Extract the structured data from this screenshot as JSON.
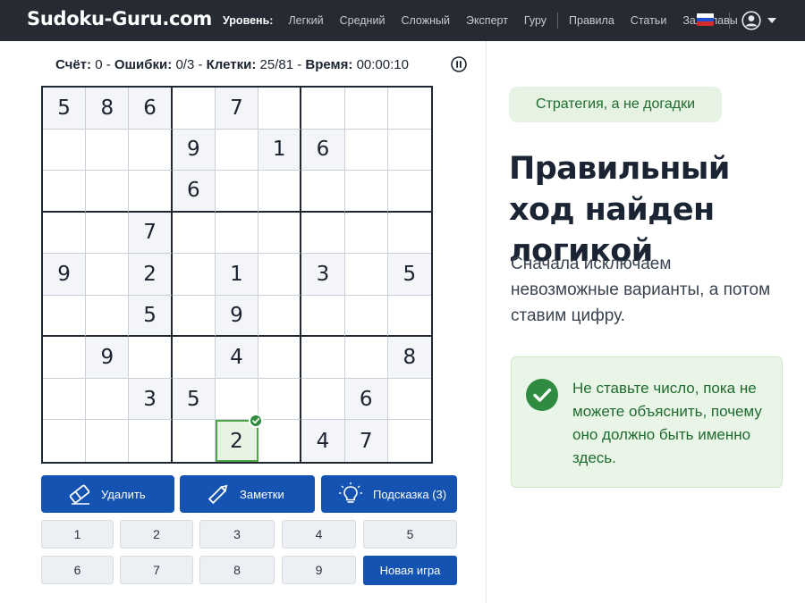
{
  "header": {
    "logo": "Sudoku-Guru.com",
    "level_label": "Уровень:",
    "levels": [
      "Легкий",
      "Средний",
      "Сложный",
      "Эксперт",
      "Гуру"
    ],
    "links": [
      "Правила",
      "Статьи",
      "Зал славы"
    ],
    "language_flag": "russian-flag-icon",
    "user_icon": "user-avatar-icon"
  },
  "status": {
    "score_label": "Счёт:",
    "score": "0",
    "errors_label": "Ошибки:",
    "errors": "0/3",
    "cells_label": "Клетки:",
    "cells": "25/81",
    "time_label": "Время:",
    "time": "00:00:10"
  },
  "grid": [
    [
      "5",
      "8",
      "6",
      "",
      "7",
      "",
      "",
      "",
      ""
    ],
    [
      "",
      "",
      "",
      "9",
      "",
      "1",
      "6",
      "",
      ""
    ],
    [
      "",
      "",
      "",
      "6",
      "",
      "",
      "",
      "",
      ""
    ],
    [
      "",
      "",
      "7",
      "",
      "",
      "",
      "",
      "",
      ""
    ],
    [
      "9",
      "",
      "2",
      "",
      "1",
      "",
      "3",
      "",
      "5"
    ],
    [
      "",
      "",
      "5",
      "",
      "9",
      "",
      "",
      "",
      ""
    ],
    [
      "",
      "9",
      "",
      "",
      "4",
      "",
      "",
      "",
      "8"
    ],
    [
      "",
      "",
      "3",
      "5",
      "",
      "",
      "",
      "6",
      ""
    ],
    [
      "",
      "",
      "",
      "",
      "2",
      "",
      "4",
      "7",
      ""
    ]
  ],
  "selected_cell": {
    "row": 9,
    "col": 5,
    "value": "2",
    "status": "correct"
  },
  "actions": {
    "delete": "Удалить",
    "notes": "Заметки",
    "hint": "Подсказка (3)"
  },
  "numbers": [
    "1",
    "2",
    "3",
    "4",
    "5",
    "6",
    "7",
    "8",
    "9"
  ],
  "new_game": "Новая игра",
  "panel": {
    "tag": "Стратегия, а не догадки",
    "headline": "Правильный ход найден логикой",
    "subtext": "Сначала исключаем невозможные варианты, а потом ставим цифру.",
    "tip": "Не ставьте число, пока не можете объяснить, почему оно должно быть именно здесь."
  },
  "colors": {
    "topbar": "#262b33",
    "primary": "#1553b3",
    "success": "#2e8b3f",
    "tip_bg": "#e9f5e6"
  }
}
